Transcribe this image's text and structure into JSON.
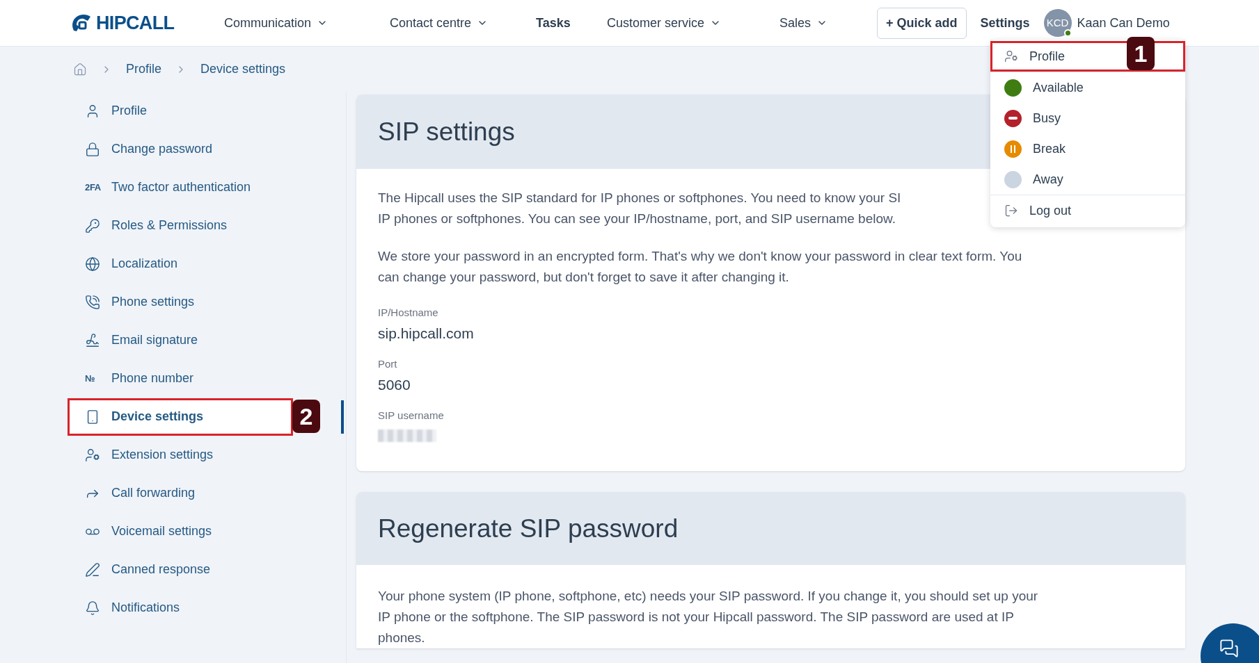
{
  "header": {
    "logo": "HIPCALL",
    "nav": [
      {
        "label": "Communication",
        "dropdown": true
      },
      {
        "label": "Contact centre",
        "dropdown": true
      },
      {
        "label": "Tasks",
        "dropdown": false
      },
      {
        "label": "Customer service",
        "dropdown": true
      },
      {
        "label": "Sales",
        "dropdown": true
      }
    ],
    "quick_add": "+ Quick add",
    "settings": "Settings",
    "avatar_initials": "KCD",
    "user_name": "Kaan Can Demo"
  },
  "breadcrumb": [
    "Profile",
    "Device settings"
  ],
  "sidebar": {
    "items": [
      {
        "label": "Profile",
        "selected": false
      },
      {
        "label": "Change password",
        "selected": false
      },
      {
        "label": "Two factor authentication",
        "glyph": "2FA",
        "selected": false
      },
      {
        "label": "Roles & Permissions",
        "selected": false
      },
      {
        "label": "Localization",
        "selected": false
      },
      {
        "label": "Phone settings",
        "selected": false
      },
      {
        "label": "Email signature",
        "selected": false
      },
      {
        "label": "Phone number",
        "glyph": "№",
        "selected": false
      },
      {
        "label": "Device settings",
        "selected": true,
        "annotation": "2"
      },
      {
        "label": "Extension settings",
        "selected": false
      },
      {
        "label": "Call forwarding",
        "selected": false
      },
      {
        "label": "Voicemail settings",
        "selected": false
      },
      {
        "label": "Canned response",
        "selected": false
      },
      {
        "label": "Notifications",
        "selected": false
      }
    ]
  },
  "sip_settings": {
    "title": "SIP settings",
    "paragraphs": [
      [
        "The Hipcall uses the SIP standard for IP phones or softphones. You need to know your SI",
        "IP phones or softphones. You can see your IP/hostname, port, and SIP username below."
      ],
      [
        "We store your password in an encrypted form. That's why we don't know your password in clear text form. You",
        "can change your password, but don't forget to save it after changing it."
      ]
    ],
    "fields": [
      {
        "label": "IP/Hostname",
        "value": "sip.hipcall.com",
        "kind": "text"
      },
      {
        "label": "Port",
        "value": "5060",
        "kind": "text"
      },
      {
        "label": "SIP username",
        "kind": "redacted"
      }
    ]
  },
  "regenerate": {
    "title": "Regenerate SIP password",
    "lines": [
      "Your phone system (IP phone, softphone, etc) needs your SIP password. If you change it, you should set up your",
      "IP phone or the softphone. The SIP password is not your Hipcall password. The SIP password are used at IP",
      "phones."
    ]
  },
  "user_menu": {
    "items": [
      {
        "kind": "link",
        "label": "Profile",
        "annotation": "1"
      },
      {
        "kind": "status",
        "label": "Available",
        "color": "#3f7d12"
      },
      {
        "kind": "status",
        "label": "Busy",
        "color": "#b3212b"
      },
      {
        "kind": "status",
        "label": "Break",
        "color": "#e68a00"
      },
      {
        "kind": "status",
        "label": "Away",
        "color": "#cbd5e1"
      },
      {
        "kind": "link",
        "label": "Log out"
      }
    ]
  }
}
